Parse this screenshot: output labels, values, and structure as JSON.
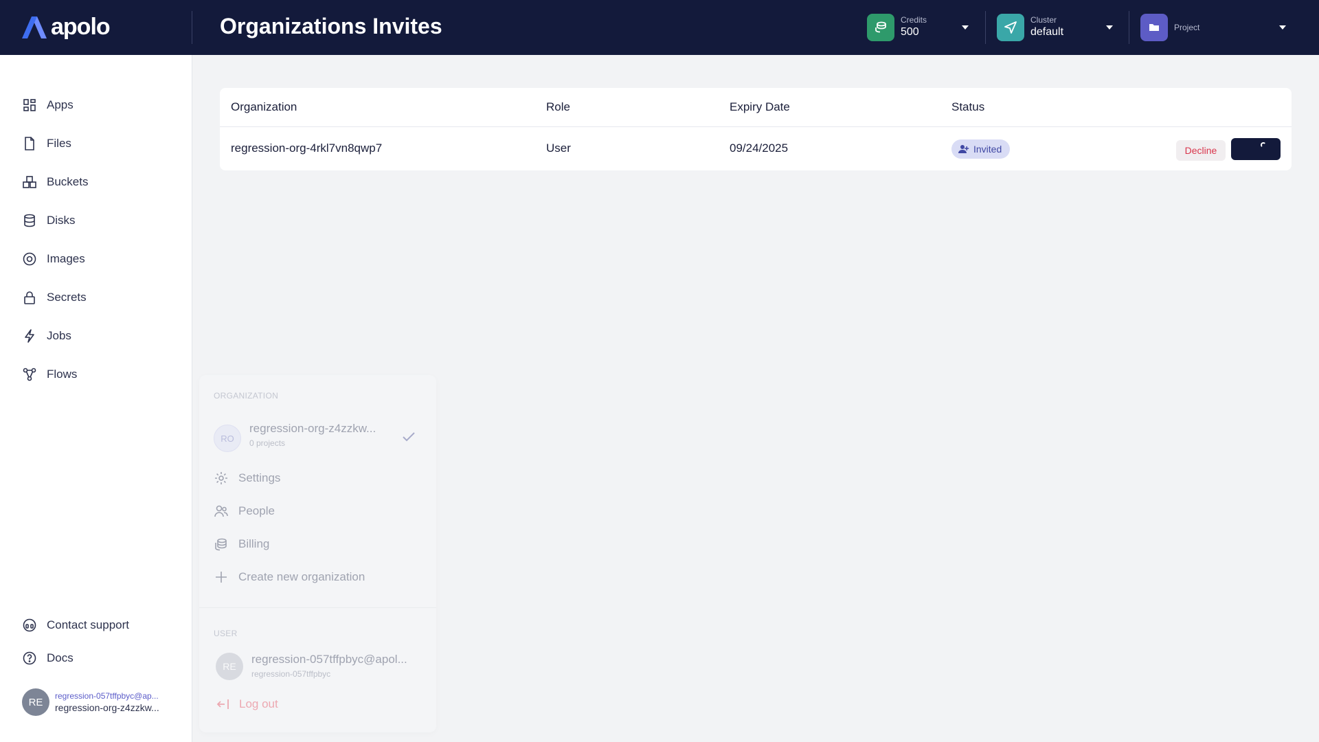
{
  "header": {
    "logo_text": "apolo",
    "title": "Organizations Invites",
    "credits": {
      "label": "Credits",
      "value": "500"
    },
    "cluster": {
      "label": "Cluster",
      "value": "default"
    },
    "project": {
      "label": "Project"
    },
    "colors": {
      "background": "#131a3b",
      "credits_icon": "#2e9a6b",
      "cluster_icon": "#3aa7a8",
      "project_icon": "#5d5cc5"
    }
  },
  "sidebar": {
    "items": [
      {
        "label": "Apps",
        "icon": "apps-grid-icon"
      },
      {
        "label": "Files",
        "icon": "file-icon"
      },
      {
        "label": "Buckets",
        "icon": "buckets-icon"
      },
      {
        "label": "Disks",
        "icon": "database-icon"
      },
      {
        "label": "Images",
        "icon": "image-disc-icon"
      },
      {
        "label": "Secrets",
        "icon": "lock-icon"
      },
      {
        "label": "Jobs",
        "icon": "lightning-icon"
      },
      {
        "label": "Flows",
        "icon": "flow-icon"
      }
    ],
    "bottom_items": [
      {
        "label": "Contact support",
        "icon": "headset-icon"
      },
      {
        "label": "Docs",
        "icon": "help-circle-icon"
      }
    ],
    "user": {
      "initials": "RE",
      "email": "regression-057tffpbyc@ap...",
      "org": "regression-org-z4zzkw..."
    }
  },
  "table": {
    "headers": [
      "Organization",
      "Role",
      "Expiry Date",
      "Status"
    ],
    "rows": [
      {
        "organization": "regression-org-4rkl7vn8qwp7",
        "role": "User",
        "expiry": "09/24/2025",
        "status": "Invited",
        "decline_label": "Decline"
      }
    ]
  },
  "org_panel": {
    "section_org": "ORGANIZATION",
    "org": {
      "initials": "RO",
      "name": "regression-org-z4zzkw...",
      "projects": "0 projects"
    },
    "items": [
      {
        "label": "Settings",
        "icon": "gear-icon"
      },
      {
        "label": "People",
        "icon": "people-icon"
      },
      {
        "label": "Billing",
        "icon": "billing-icon"
      },
      {
        "label": "Create new organization",
        "icon": "plus-icon"
      }
    ],
    "section_user": "USER",
    "user": {
      "initials": "RE",
      "email": "regression-057tffpbyc@apol...",
      "username": "regression-057tffpbyc"
    },
    "logout_label": "Log out"
  }
}
